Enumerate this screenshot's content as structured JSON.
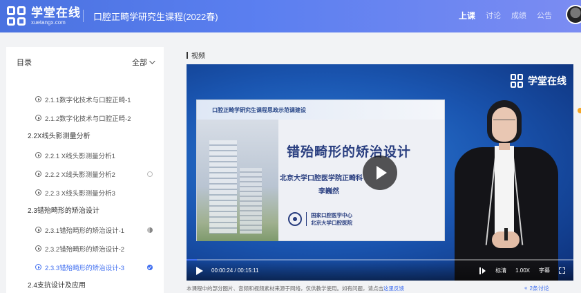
{
  "header": {
    "logo_cn": "学堂在线",
    "logo_en": "xuetangx.com",
    "course_title": "口腔正畸学研究生课程(2022春)",
    "nav": [
      {
        "label": "上课",
        "active": true
      },
      {
        "label": "讨论",
        "active": false
      },
      {
        "label": "成绩",
        "active": false
      },
      {
        "label": "公告",
        "active": false
      }
    ]
  },
  "sidebar": {
    "title": "目录",
    "filter_label": "全部",
    "sections": [
      {
        "items": [
          {
            "label": "2.1.1数字化技术与口腔正畸-1",
            "status": "none",
            "active": false
          },
          {
            "label": "2.1.2数字化技术与口腔正畸-2",
            "status": "none",
            "active": false
          }
        ]
      },
      {
        "title": "2.2X线头影测量分析",
        "items": [
          {
            "label": "2.2.1 X线头影测量分析1",
            "status": "none",
            "active": false
          },
          {
            "label": "2.2.2 X线头影测量分析2",
            "status": "empty",
            "active": false
          },
          {
            "label": "2.2.3 X线头影测量分析3",
            "status": "none",
            "active": false
          }
        ]
      },
      {
        "title": "2.3错殆畸形的矫治设计",
        "items": [
          {
            "label": "2.3.1错殆畸形的矫治设计-1",
            "status": "half",
            "active": false
          },
          {
            "label": "2.3.2错殆畸形的矫治设计-2",
            "status": "none",
            "active": false
          },
          {
            "label": "2.3.3错殆畸形的矫治设计-3",
            "status": "done",
            "active": true
          }
        ]
      },
      {
        "title": "2.4支抗设计及应用",
        "items": []
      }
    ]
  },
  "main": {
    "section_label": "视频",
    "video": {
      "brand": "学堂在线",
      "slide_subtitle": "口腔正畸学研究生课程思政示范课建设",
      "slide_title": "错殆畸形的矫治设计",
      "slide_org": "北京大学口腔医学院正畸科",
      "slide_name": "李巍然",
      "slide_logo_line1": "国家口腔医学中心",
      "slide_logo_line2": "北京大学口腔医院",
      "current_time": "00:00:24",
      "duration": "00:15:11",
      "progress_fraction": 0.026,
      "quality": "标清",
      "speed": "1.00X",
      "subtitle_label": "字幕"
    },
    "disclaimer": "本课程中的部分图片、音频和视频素材来源于网络，仅供教学使用。如有问题，请点击",
    "disclaimer_link": "这里反馈",
    "discuss_tab": "2条讨论"
  }
}
